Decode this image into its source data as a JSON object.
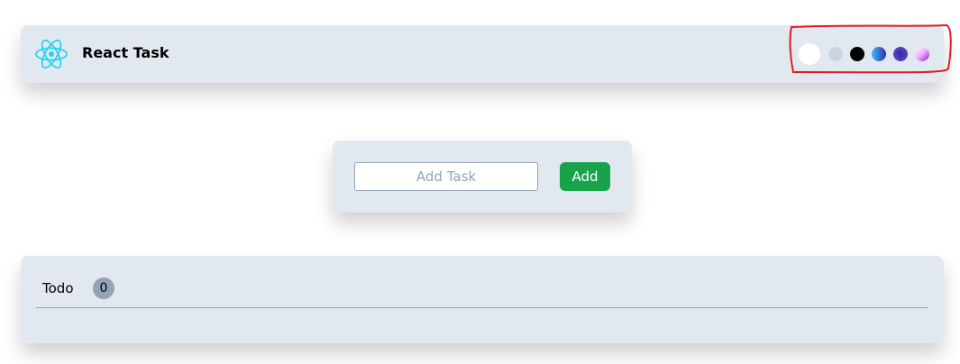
{
  "header": {
    "title": "React Task",
    "logo_icon": "react-logo-icon",
    "themes": [
      {
        "name": "white",
        "color": "#ffffff"
      },
      {
        "name": "light-gray",
        "color": "#cbd5e1"
      },
      {
        "name": "black",
        "color": "#000000"
      },
      {
        "name": "blue-gradient",
        "color": "linear-gradient(90deg,#38bdf8,#3730a3)"
      },
      {
        "name": "purple-x",
        "color": "radial-gradient(circle,#1e3a8a,#7c3aed)"
      },
      {
        "name": "pink-gradient",
        "color": "linear-gradient(135deg,#fff,#f0abfc,#7e22ce)"
      }
    ]
  },
  "form": {
    "placeholder": "Add Task",
    "value": "",
    "add_label": "Add"
  },
  "todo": {
    "label": "Todo",
    "count": "0"
  },
  "annotation_color": "#e11d22"
}
